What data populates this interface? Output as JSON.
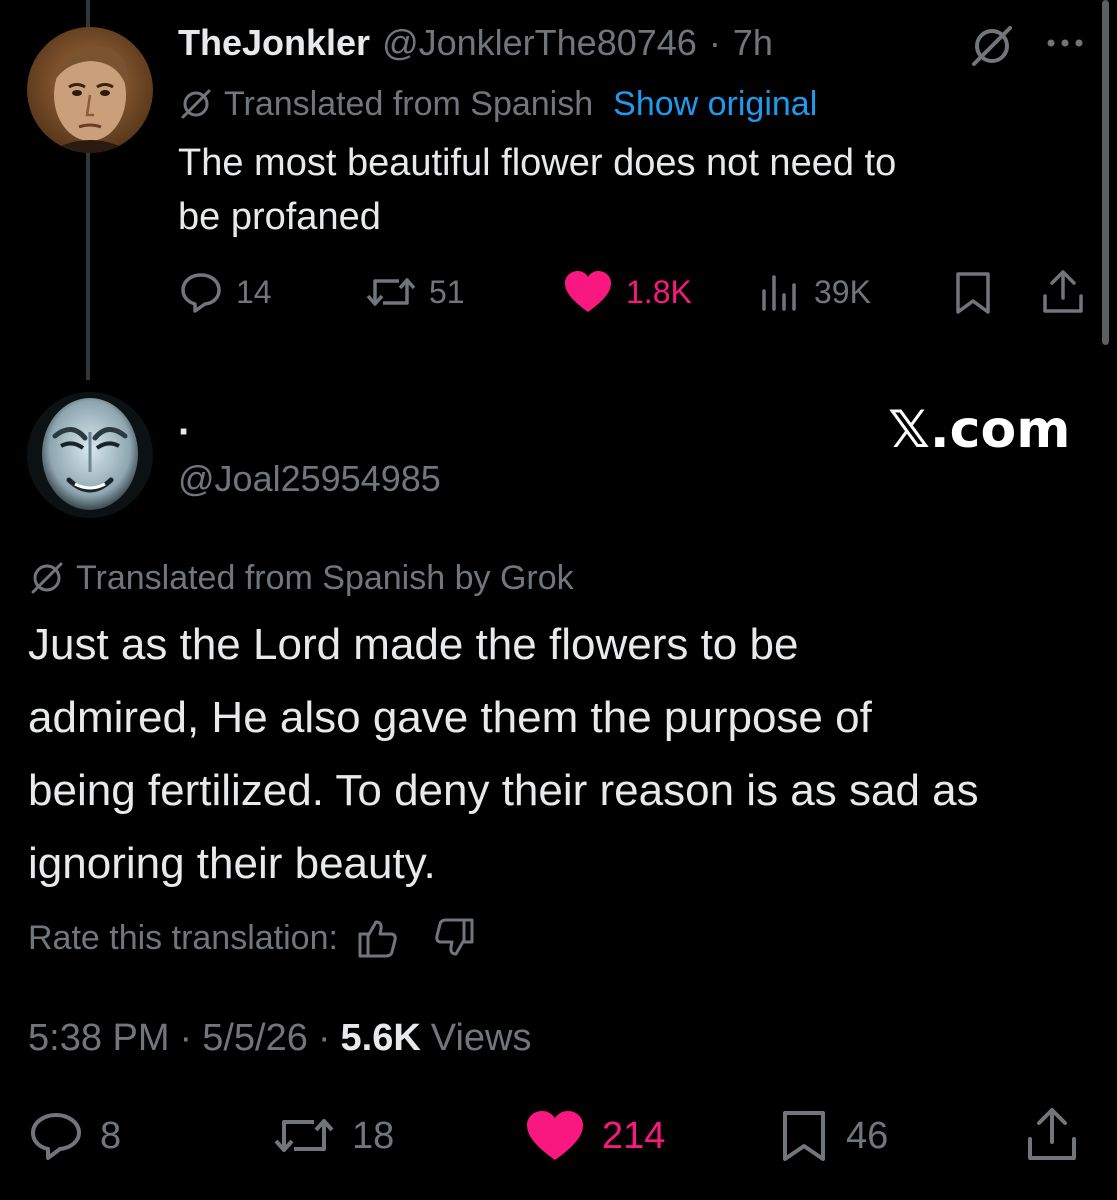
{
  "parent_post": {
    "display_name": "TheJonkler",
    "handle": "@JonklerThe80746",
    "separator": "·",
    "time_ago": "7h",
    "translated_label": "Translated from Spanish",
    "show_original": "Show original",
    "text_line1": "The most beautiful flower does not need to",
    "text_line2": "be profaned",
    "replies": "14",
    "reposts": "51",
    "likes": "1.8K",
    "views": "39K"
  },
  "reply_post": {
    "display_name": "·",
    "handle": "@Joal25954985",
    "watermark": "𝕏.com",
    "translated_label": "Translated from Spanish by Grok",
    "text_line1": "Just as the Lord made the flowers to be",
    "text_line2": "admired, He also gave them the purpose of",
    "text_line3": "being fertilized. To deny their reason is as sad as",
    "text_line4": "ignoring their beauty.",
    "rate_label": "Rate this translation:",
    "time": "5:38 PM",
    "dot1": "·",
    "date": "5/5/26",
    "dot2": "·",
    "views_count": "5.6K",
    "views_label": "Views",
    "replies": "8",
    "reposts": "18",
    "likes": "214",
    "bookmarks": "46"
  },
  "colors": {
    "background": "#000000",
    "text": "#e7e9ea",
    "muted": "#71767b",
    "link": "#1d9bf0",
    "like": "#f91880"
  }
}
